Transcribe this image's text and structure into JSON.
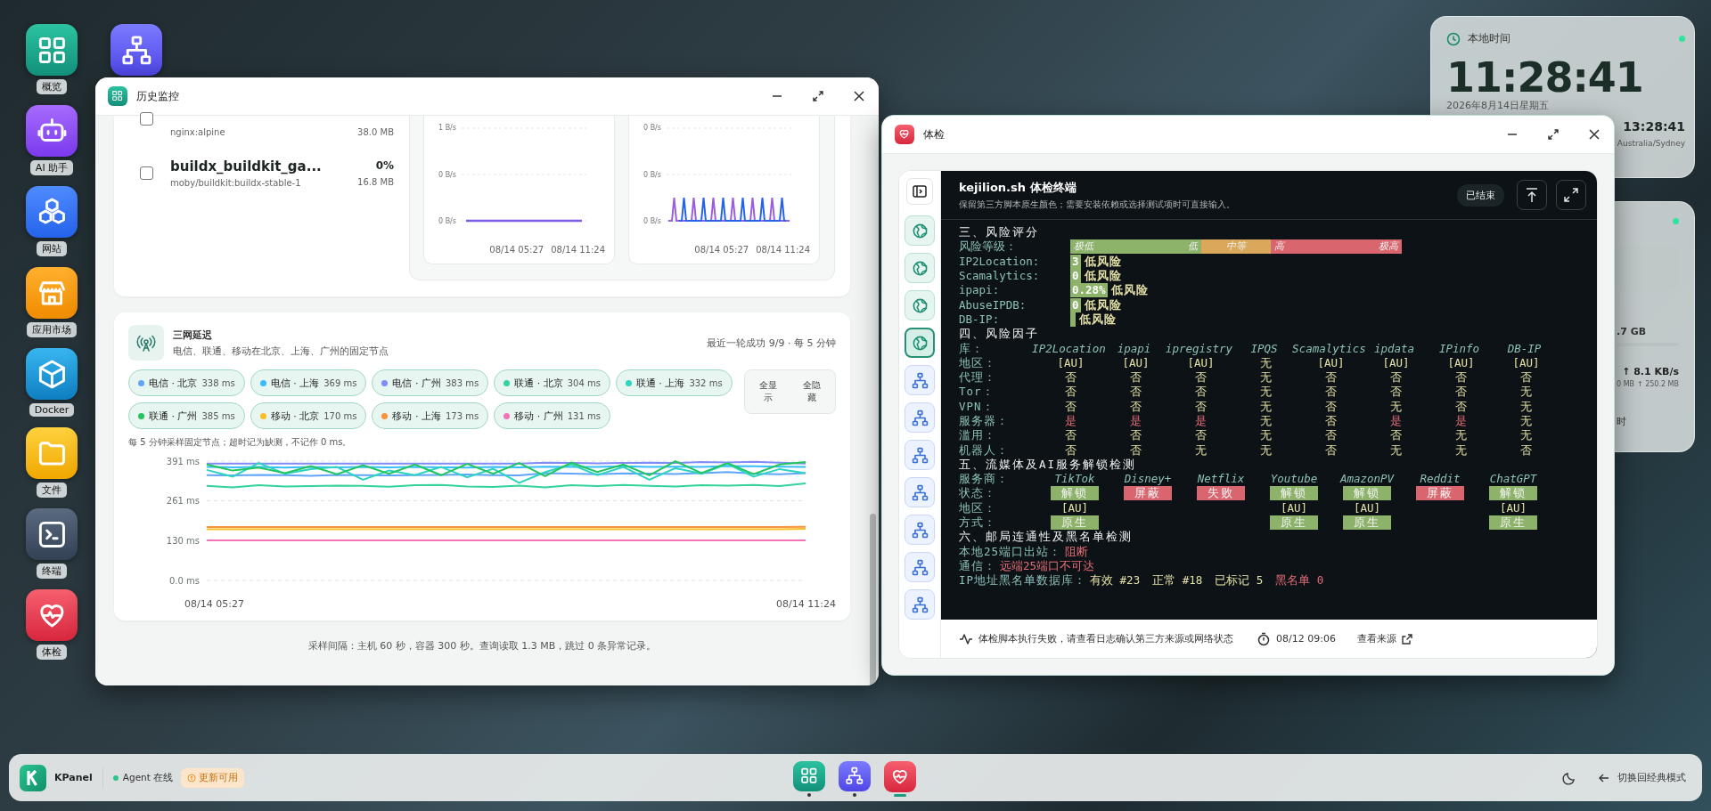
{
  "desktop": {
    "apps": [
      {
        "kind": "grid",
        "label": "概览"
      },
      {
        "kind": "robot",
        "label": "AI 助手"
      },
      {
        "kind": "cubes",
        "label": "网站"
      },
      {
        "kind": "store",
        "label": "应用市场"
      },
      {
        "kind": "box",
        "label": "Docker"
      },
      {
        "kind": "folder",
        "label": "文件"
      },
      {
        "kind": "terminal",
        "label": "终端"
      },
      {
        "kind": "heart",
        "label": "体检"
      }
    ],
    "extra_app": {
      "kind": "network"
    }
  },
  "clock_widget": {
    "title": "本地时间",
    "time": "11:28:41",
    "date": "2026年8月14日星期五",
    "remote_time": "13:28:41",
    "remote_zone": "Australia/Sydney"
  },
  "stats_widget": {
    "memory": ".7 GB",
    "upload_rate": "↑ 8.1 KB/s",
    "download_total": "0 MB",
    "upload_total": "↑ 250.2 MB",
    "footer": "时"
  },
  "history_window": {
    "title": "历史监控",
    "containers": [
      {
        "image": "nginx:alpine",
        "memory": "38.0 MB",
        "checked": false
      },
      {
        "name": "buildx_buildkit_ga...",
        "cpu": "0%",
        "image": "moby/buildkit:buildx-stable-1",
        "memory": "16.8 MB",
        "checked": false
      }
    ],
    "mini_charts": [
      {
        "kind": "flat",
        "ticks": [
          "1 B/s",
          "0 B/s",
          "0 B/s"
        ],
        "x_labels": [
          "08/14 05:27",
          "08/14 11:24"
        ]
      },
      {
        "kind": "spikes",
        "ticks": [
          "0 B/s",
          "0 B/s",
          "0 B/s"
        ],
        "x_labels": [
          "08/14 05:27",
          "08/14 11:24"
        ]
      }
    ],
    "latency": {
      "title": "三网延迟",
      "subtitle": "电信、联通、移动在北京、上海、广州的固定节点",
      "status": "最近一轮成功 9/9 · 每 5 分钟",
      "node_values": [
        "338 ms",
        "369 ms",
        "383 ms",
        "304 ms",
        "332 ms",
        "385 ms",
        "170 ms",
        "173 ms",
        "131 ms"
      ],
      "buttons": [
        "全显示",
        "全隐藏"
      ],
      "note": "每 5 分钟采样固定节点；超时记为缺测，不记作 0 ms。",
      "chart_data": {
        "type": "line",
        "ylim": [
          0,
          391
        ],
        "yticks": [
          {
            "value": 0,
            "label": "0.0 ms"
          },
          {
            "value": 130,
            "label": "130 ms"
          },
          {
            "value": 261,
            "label": "261 ms"
          },
          {
            "value": 391,
            "label": "391 ms"
          }
        ],
        "series": [
          {
            "name": "电信 · 北京",
            "color": "#60a5fa",
            "values": [
              345,
              344,
              346,
              345,
              343,
              346,
              345,
              344,
              345,
              346,
              347,
              345,
              344,
              352,
              350,
              348,
              351,
              350,
              349,
              352,
              355,
              350,
              348,
              352
            ]
          },
          {
            "name": "电信 · 上海",
            "color": "#38bdf8",
            "values": [
              372,
              371,
              372,
              370,
              372,
              371,
              372,
              371,
              372,
              371,
              370,
              372,
              371,
              373,
              372,
              372,
              374,
              372,
              373,
              372,
              375,
              374,
              373,
              372
            ]
          },
          {
            "name": "电信 · 广州",
            "color": "#818cf8",
            "values": [
              383,
              383,
              383,
              383,
              383,
              383,
              383,
              383,
              383,
              383,
              383,
              383,
              383,
              386,
              385,
              384,
              385,
              386,
              385,
              388,
              387,
              389,
              386,
              383
            ]
          },
          {
            "name": "联通 · 北京",
            "color": "#34d399",
            "values": [
              310,
              305,
              312,
              308,
              309,
              311,
              310,
              307,
              312,
              313,
              308,
              306,
              311,
              305,
              312,
              309,
              313,
              310,
              308,
              312,
              311,
              313,
              309,
              318
            ]
          },
          {
            "name": "联通 · 上海",
            "color": "#2dd4bf",
            "values": [
              362,
              340,
              385,
              350,
              365,
              372,
              330,
              360,
              345,
              372,
              338,
              366,
              320,
              355,
              380,
              345,
              372,
              330,
              368,
              350,
              382,
              340,
              365,
              352
            ]
          },
          {
            "name": "联通 · 广州",
            "color": "#22c55e",
            "values": [
              380,
              360,
              370,
              352,
              375,
              348,
              378,
              350,
              380,
              345,
              382,
              350,
              385,
              342,
              386,
              355,
              380,
              345,
              391,
              352,
              385,
              348,
              380,
              388
            ]
          },
          {
            "name": "移动 · 北京",
            "color": "#fbbf24",
            "values": [
              168,
              168,
              168,
              168,
              168,
              168,
              168,
              168,
              168,
              168,
              168,
              168,
              168,
              168,
              168,
              168,
              168,
              168,
              168,
              168,
              168,
              168,
              168,
              169
            ]
          },
          {
            "name": "移动 · 上海",
            "color": "#fb923c",
            "values": [
              175,
              175,
              175,
              175,
              175,
              175,
              175,
              175,
              175,
              175,
              175,
              175,
              175,
              175,
              175,
              175,
              175,
              175,
              175,
              175,
              175,
              175,
              175,
              176
            ]
          },
          {
            "name": "移动 · 广州",
            "color": "#f472b6",
            "values": [
              131,
              131,
              131,
              131,
              131,
              131,
              131,
              131,
              131,
              131,
              131,
              131,
              131,
              131,
              131,
              131,
              131,
              131,
              131,
              131,
              131,
              131,
              131,
              131
            ]
          }
        ]
      },
      "x_labels": [
        "08/14 05:27",
        "08/14 11:24"
      ]
    },
    "footer": "采样间隔：主机 60 秒，容器 300 秒。查询读取 1.3 MB，跳过 0 条异常记录。"
  },
  "checkup_window": {
    "title": "体检",
    "rail": [
      {
        "kind": "globe",
        "selected": false
      },
      {
        "kind": "globe",
        "selected": false
      },
      {
        "kind": "globe",
        "selected": false
      },
      {
        "kind": "globe",
        "selected": true
      },
      {
        "kind": "network",
        "selected": false
      },
      {
        "kind": "network",
        "selected": false
      },
      {
        "kind": "network",
        "selected": false
      },
      {
        "kind": "network",
        "selected": false
      },
      {
        "kind": "network",
        "selected": false
      },
      {
        "kind": "network",
        "selected": false
      },
      {
        "kind": "network",
        "selected": false
      }
    ],
    "terminal": {
      "title": "kejilion.sh 体检终端",
      "subtitle": "保留第三方脚本原生颜色；需要安装依赖或选择测试项时可直接输入。",
      "state": "已结束",
      "lines": [
        {
          "kind": "heading",
          "text": "三、风险评分"
        },
        {
          "kind": "riskbar",
          "label": "风险等级：",
          "bands": [
            {
              "kind": "ok",
              "texts": [
                "极低",
                "低"
              ]
            },
            {
              "kind": "mid",
              "texts": [
                "中等"
              ]
            },
            {
              "kind": "bad",
              "texts": [
                "高",
                "极高"
              ]
            }
          ]
        },
        {
          "kind": "score",
          "label": "IP2Location:",
          "score": "3",
          "verdict": "低风险"
        },
        {
          "kind": "score",
          "label": "Scamalytics:",
          "score": "0",
          "verdict": "低风险"
        },
        {
          "kind": "score",
          "label": "ipapi:",
          "score": "0.28%",
          "verdict": "低风险"
        },
        {
          "kind": "score",
          "label": "AbuseIPDB:",
          "score": "0",
          "verdict": "低风险"
        },
        {
          "kind": "score",
          "label": "DB-IP:",
          "verdict": "低风险"
        },
        {
          "kind": "heading",
          "text": "四、风险因子"
        },
        {
          "kind": "factor-header",
          "label": "库：",
          "cells": [
            "IP2Location",
            "ipapi",
            "ipregistry",
            "IPQS",
            "Scamalytics",
            "ipdata",
            "IPinfo",
            "DB-IP"
          ]
        },
        {
          "kind": "factor-row",
          "label": "地区：",
          "cells": [
            {
              "text": "[AU]",
              "kind": "plain"
            },
            {
              "text": "[AU]",
              "kind": "plain"
            },
            {
              "text": "[AU]",
              "kind": "plain"
            },
            {
              "text": "无",
              "kind": "plain"
            },
            {
              "text": "[AU]",
              "kind": "plain"
            },
            {
              "text": "[AU]",
              "kind": "plain"
            },
            {
              "text": "[AU]",
              "kind": "plain"
            },
            {
              "text": "[AU]",
              "kind": "plain"
            }
          ]
        },
        {
          "kind": "factor-row",
          "label": "代理：",
          "cells": [
            {
              "text": "否",
              "kind": "plain"
            },
            {
              "text": "否",
              "kind": "plain"
            },
            {
              "text": "否",
              "kind": "plain"
            },
            {
              "text": "无",
              "kind": "plain"
            },
            {
              "text": "否",
              "kind": "plain"
            },
            {
              "text": "否",
              "kind": "plain"
            },
            {
              "text": "否",
              "kind": "plain"
            },
            {
              "text": "否",
              "kind": "plain"
            }
          ]
        },
        {
          "kind": "factor-row",
          "label": "Tor：",
          "cells": [
            {
              "text": "否",
              "kind": "plain"
            },
            {
              "text": "否",
              "kind": "plain"
            },
            {
              "text": "否",
              "kind": "plain"
            },
            {
              "text": "无",
              "kind": "plain"
            },
            {
              "text": "否",
              "kind": "plain"
            },
            {
              "text": "否",
              "kind": "plain"
            },
            {
              "text": "否",
              "kind": "plain"
            },
            {
              "text": "无",
              "kind": "plain"
            }
          ]
        },
        {
          "kind": "factor-row",
          "label": "VPN：",
          "cells": [
            {
              "text": "否",
              "kind": "plain"
            },
            {
              "text": "否",
              "kind": "plain"
            },
            {
              "text": "否",
              "kind": "plain"
            },
            {
              "text": "无",
              "kind": "plain"
            },
            {
              "text": "否",
              "kind": "plain"
            },
            {
              "text": "无",
              "kind": "plain"
            },
            {
              "text": "否",
              "kind": "plain"
            },
            {
              "text": "无",
              "kind": "plain"
            }
          ]
        },
        {
          "kind": "factor-row",
          "label": "服务器：",
          "cells": [
            {
              "text": "是",
              "kind": "alert"
            },
            {
              "text": "是",
              "kind": "alert"
            },
            {
              "text": "是",
              "kind": "alert"
            },
            {
              "text": "无",
              "kind": "plain"
            },
            {
              "text": "否",
              "kind": "plain"
            },
            {
              "text": "是",
              "kind": "alert"
            },
            {
              "text": "是",
              "kind": "alert"
            },
            {
              "text": "无",
              "kind": "plain"
            }
          ]
        },
        {
          "kind": "factor-row",
          "label": "滥用：",
          "cells": [
            {
              "text": "否",
              "kind": "plain"
            },
            {
              "text": "否",
              "kind": "plain"
            },
            {
              "text": "否",
              "kind": "plain"
            },
            {
              "text": "无",
              "kind": "plain"
            },
            {
              "text": "否",
              "kind": "plain"
            },
            {
              "text": "否",
              "kind": "plain"
            },
            {
              "text": "无",
              "kind": "plain"
            },
            {
              "text": "无",
              "kind": "plain"
            }
          ]
        },
        {
          "kind": "factor-row",
          "label": "机器人：",
          "cells": [
            {
              "text": "否",
              "kind": "plain"
            },
            {
              "text": "否",
              "kind": "plain"
            },
            {
              "text": "无",
              "kind": "plain"
            },
            {
              "text": "无",
              "kind": "plain"
            },
            {
              "text": "否",
              "kind": "plain"
            },
            {
              "text": "无",
              "kind": "plain"
            },
            {
              "text": "无",
              "kind": "plain"
            },
            {
              "text": "否",
              "kind": "plain"
            }
          ]
        },
        {
          "kind": "heading",
          "text": "五、流媒体及AI服务解锁检测"
        },
        {
          "kind": "service-header",
          "label": "服务商：",
          "cells": [
            "TikTok",
            "Disney+",
            "Netflix",
            "Youtube",
            "AmazonPV",
            "Reddit",
            "ChatGPT"
          ]
        },
        {
          "kind": "service-row",
          "label": "状态：",
          "cells": [
            {
              "text": "解锁",
              "kind": "ok"
            },
            {
              "text": "屏蔽",
              "kind": "bad"
            },
            {
              "text": "失败",
              "kind": "bad"
            },
            {
              "text": "解锁",
              "kind": "ok"
            },
            {
              "text": "解锁",
              "kind": "ok"
            },
            {
              "text": "屏蔽",
              "kind": "bad"
            },
            {
              "text": "解锁",
              "kind": "ok"
            }
          ]
        },
        {
          "kind": "service-row",
          "label": "地区：",
          "cells": [
            {
              "text": "[AU]",
              "kind": "plain"
            },
            {
              "kind": "blank"
            },
            {
              "kind": "blank"
            },
            {
              "text": "[AU]",
              "kind": "plain"
            },
            {
              "text": "[AU]",
              "kind": "plain"
            },
            {
              "kind": "blank"
            },
            {
              "text": "[AU]",
              "kind": "plain"
            }
          ]
        },
        {
          "kind": "service-row",
          "label": "方式：",
          "cells": [
            {
              "text": "原生",
              "kind": "ok"
            },
            {
              "kind": "blank"
            },
            {
              "kind": "blank"
            },
            {
              "text": "原生",
              "kind": "ok"
            },
            {
              "text": "原生",
              "kind": "ok"
            },
            {
              "kind": "blank"
            },
            {
              "text": "原生",
              "kind": "ok"
            }
          ]
        },
        {
          "kind": "heading",
          "text": "六、邮局连通性及黑名单检测"
        },
        {
          "kind": "status",
          "label": "本地25端口出站：",
          "segments": [
            {
              "text": "阻断",
              "kind": "alert"
            }
          ]
        },
        {
          "kind": "status",
          "label": "通信：",
          "segments": [
            {
              "text": "远端25端口不可达",
              "kind": "alert"
            }
          ]
        },
        {
          "kind": "status",
          "label": "IP地址黑名单数据库：",
          "segments": [
            {
              "text": "有效 #23",
              "kind": "plain"
            },
            {
              "text": "正常 #18",
              "kind": "plain"
            },
            {
              "text": "已标记 5",
              "kind": "plain"
            },
            {
              "text": "黑名单 0",
              "kind": "alert"
            }
          ]
        }
      ]
    },
    "footer": {
      "message": "体检脚本执行失败，请查看日志确认第三方来源或网络状态",
      "time": "08/12 09:06",
      "link": "查看来源"
    }
  },
  "taskbar": {
    "brand": "KPanel",
    "agent": "Agent 在线",
    "update": "更新可用",
    "apps": [
      {
        "kind": "grid",
        "running": true,
        "selected": false
      },
      {
        "kind": "network",
        "running": true,
        "selected": false
      },
      {
        "kind": "heart",
        "running": true,
        "selected": true
      }
    ],
    "switch": "切换回经典模式"
  }
}
